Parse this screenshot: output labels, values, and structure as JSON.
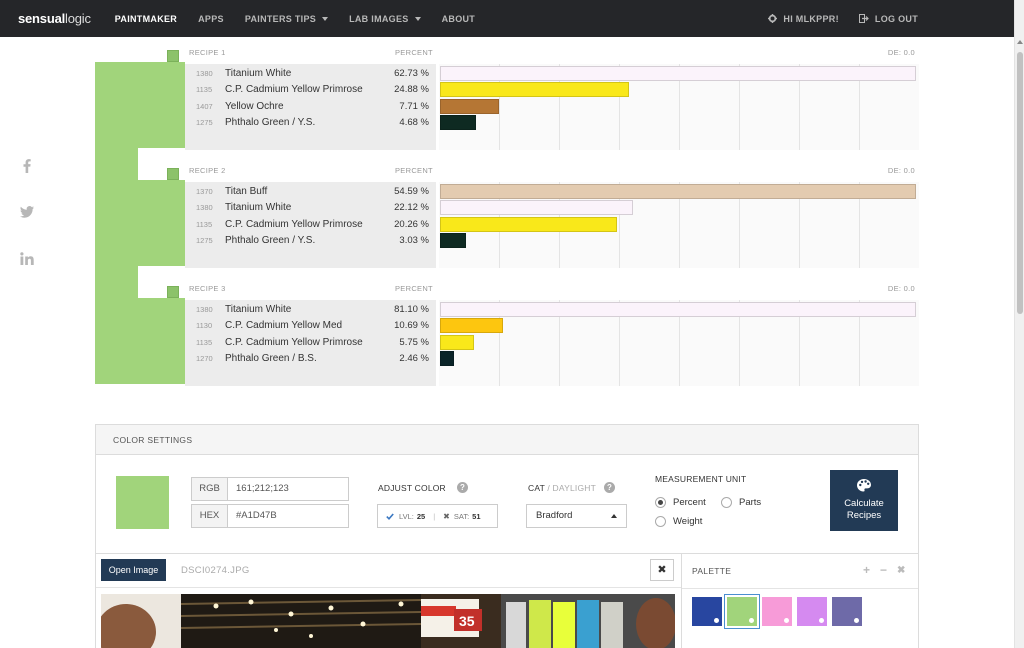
{
  "nav": {
    "brand_bold": "sensual",
    "brand_light": "logic",
    "items": [
      {
        "label": "PAINTMAKER"
      },
      {
        "label": "APPS"
      },
      {
        "label": "PAINTERS TIPS"
      },
      {
        "label": "LAB IMAGES"
      },
      {
        "label": "ABOUT"
      }
    ],
    "user_greeting": "HI MLKPPR!",
    "logout": "LOG OUT"
  },
  "social": [
    "facebook-icon",
    "twitter-icon",
    "linkedin-icon"
  ],
  "target_color": "#A1D47B",
  "recipes": [
    {
      "title": "RECIPE 1",
      "percent_header": "PERCENT",
      "de": "DE: 0.0",
      "paints": [
        {
          "code": "1380",
          "name": "Titanium White",
          "percent": "62.73 %",
          "value": 62.73,
          "color": "#FBF3FB"
        },
        {
          "code": "1135",
          "name": "C.P. Cadmium Yellow Primrose",
          "percent": "24.88 %",
          "value": 24.88,
          "color": "#F9E81A"
        },
        {
          "code": "1407",
          "name": "Yellow Ochre",
          "percent": "7.71 %",
          "value": 7.71,
          "color": "#B57634"
        },
        {
          "code": "1275",
          "name": "Phthalo Green / Y.S.",
          "percent": "4.68 %",
          "value": 4.68,
          "color": "#0E2A22"
        }
      ]
    },
    {
      "title": "RECIPE 2",
      "percent_header": "PERCENT",
      "de": "DE: 0.0",
      "paints": [
        {
          "code": "1370",
          "name": "Titan Buff",
          "percent": "54.59 %",
          "value": 54.59,
          "color": "#E3CBB0"
        },
        {
          "code": "1380",
          "name": "Titanium White",
          "percent": "22.12 %",
          "value": 22.12,
          "color": "#FBF3FB"
        },
        {
          "code": "1135",
          "name": "C.P. Cadmium Yellow Primrose",
          "percent": "20.26 %",
          "value": 20.26,
          "color": "#F9E81A"
        },
        {
          "code": "1275",
          "name": "Phthalo Green / Y.S.",
          "percent": "3.03 %",
          "value": 3.03,
          "color": "#0E2A22"
        }
      ]
    },
    {
      "title": "RECIPE 3",
      "percent_header": "PERCENT",
      "de": "DE: 0.0",
      "paints": [
        {
          "code": "1380",
          "name": "Titanium White",
          "percent": "81.10 %",
          "value": 81.1,
          "color": "#FBF3FB"
        },
        {
          "code": "1130",
          "name": "C.P. Cadmium Yellow Med",
          "percent": "10.69 %",
          "value": 10.69,
          "color": "#FDC60F"
        },
        {
          "code": "1135",
          "name": "C.P. Cadmium Yellow Primrose",
          "percent": "5.75 %",
          "value": 5.75,
          "color": "#F9E81A"
        },
        {
          "code": "1270",
          "name": "Phthalo Green / B.S.",
          "percent": "2.46 %",
          "value": 2.46,
          "color": "#0A2428"
        }
      ]
    }
  ],
  "settings": {
    "title": "COLOR SETTINGS",
    "rgb_label": "RGB",
    "rgb_value": "161;212;123",
    "hex_label": "HEX",
    "hex_value": "#A1D47B",
    "adjust_label": "ADJUST COLOR",
    "lvl_label": "LVL:",
    "lvl_value": "25",
    "sat_label": "SAT:",
    "sat_value": "51",
    "cat_label": "CAT",
    "daylight_label": "/ DAYLIGHT",
    "cat_value": "Bradford",
    "measure_label": "MEASUREMENT UNIT",
    "units": [
      "Percent",
      "Parts",
      "Weight"
    ],
    "selected_unit": "Percent",
    "calc_line1": "Calculate",
    "calc_line2": "Recipes"
  },
  "image": {
    "open_label": "Open Image",
    "filename": "DSCI0274.JPG",
    "close_glyph": "✖"
  },
  "palette": {
    "title": "PALETTE",
    "add": "+",
    "remove": "−",
    "clear": "✖",
    "swatches": [
      "#2846A0",
      "#A1D47B",
      "#F79BD8",
      "#D58AF0",
      "#6E6AA8"
    ],
    "selected": 1
  }
}
